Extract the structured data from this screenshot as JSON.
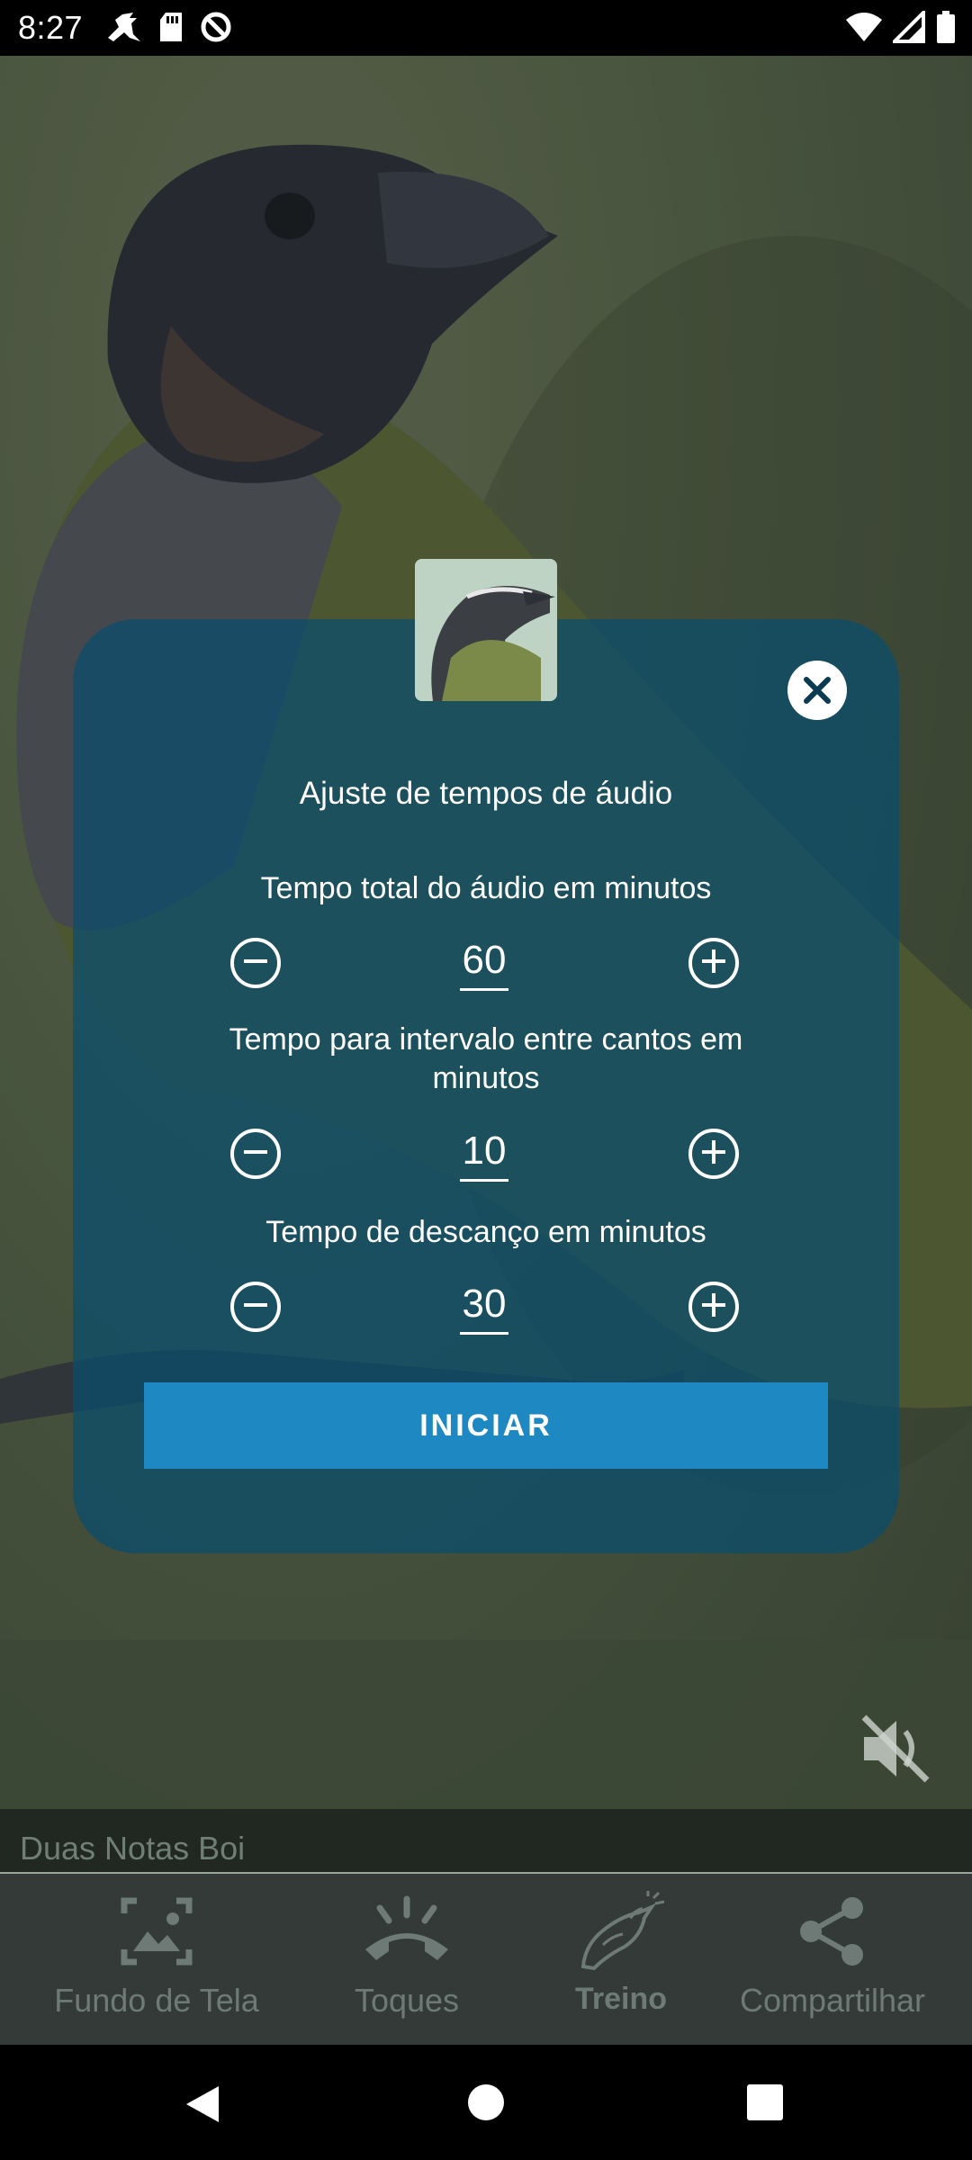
{
  "status_bar": {
    "time": "8:27",
    "left_icons": [
      "bird-notification-icon",
      "sd-card-icon",
      "no-sync-icon"
    ],
    "right_icons": [
      "wifi-icon",
      "signal-icon",
      "battery-icon"
    ]
  },
  "dialog": {
    "title": "Ajuste de tempos de áudio",
    "close_icon": "close-icon",
    "thumbnail": "bird-thumbnail",
    "fields": [
      {
        "label": "Tempo total do áudio em minutos",
        "value": "60"
      },
      {
        "label": "Tempo para intervalo entre cantos em minutos",
        "value": "10"
      },
      {
        "label": "Tempo de descanço em minutos",
        "value": "30"
      }
    ],
    "start_label": "INICIAR",
    "accent": "#1e88c3",
    "panel_color": "#084e6e"
  },
  "player": {
    "song_title": "Duas Notas Boi",
    "mute_icon": "volume-off-icon"
  },
  "bottom_nav": {
    "items": [
      {
        "label": "Fundo de Tela",
        "icon": "wallpaper-icon",
        "active": false
      },
      {
        "label": "Toques",
        "icon": "ringtone-icon",
        "active": false
      },
      {
        "label": "Treino",
        "icon": "bird-training-icon",
        "active": true
      },
      {
        "label": "Compartilhar",
        "icon": "share-icon",
        "active": false
      }
    ]
  },
  "system_nav": [
    "back-icon",
    "home-icon",
    "recents-icon"
  ]
}
